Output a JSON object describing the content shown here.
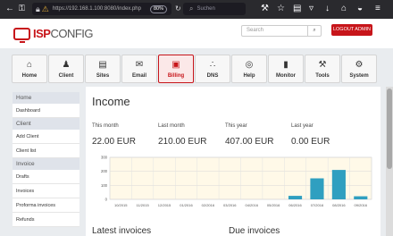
{
  "browser": {
    "url": "https://192.168.1.100:8080/index.php",
    "zoom": "80%",
    "search_placeholder": "Suchen"
  },
  "header": {
    "logo_isp": "ISP",
    "logo_config": "CONFIG",
    "search_placeholder": "Search",
    "logout_label": "LOGOUT ADMIN"
  },
  "modules": [
    {
      "label": "Home",
      "icon": "home-icon"
    },
    {
      "label": "Client",
      "icon": "users-icon"
    },
    {
      "label": "Sites",
      "icon": "sites-icon"
    },
    {
      "label": "Email",
      "icon": "email-icon"
    },
    {
      "label": "Billing",
      "icon": "billing-icon",
      "active": true
    },
    {
      "label": "DNS",
      "icon": "dns-icon"
    },
    {
      "label": "Help",
      "icon": "help-icon"
    },
    {
      "label": "Monitor",
      "icon": "monitor-icon"
    },
    {
      "label": "Tools",
      "icon": "tools-icon"
    },
    {
      "label": "System",
      "icon": "gear-icon"
    }
  ],
  "sidebar": {
    "home_head": "Home",
    "dashboard": "Dashboard",
    "client_head": "Client",
    "add_client": "Add Client",
    "client_list": "Client list",
    "invoice_head": "Invoice",
    "drafts": "Drafts",
    "invoices": "Invoices",
    "proforma": "Proforma invoices",
    "refunds": "Refunds"
  },
  "main": {
    "title": "Income",
    "stats": {
      "this_month_label": "This month",
      "this_month_value": "22.00 EUR",
      "last_month_label": "Last month",
      "last_month_value": "210.00 EUR",
      "this_year_label": "This year",
      "this_year_value": "407.00 EUR",
      "last_year_label": "Last year",
      "last_year_value": "0.00 EUR"
    },
    "latest_invoices": "Latest invoices",
    "due_invoices": "Due invoices"
  },
  "chart_data": {
    "type": "bar",
    "categories": [
      "10/2015",
      "11/2015",
      "12/2015",
      "01/2016",
      "02/2016",
      "03/2016",
      "04/2016",
      "05/2016",
      "06/2016",
      "07/2016",
      "08/2016",
      "09/2016"
    ],
    "values": [
      0,
      0,
      0,
      0,
      0,
      0,
      0,
      0,
      25,
      150,
      210,
      22
    ],
    "ylim": [
      0,
      300
    ],
    "yticks": [
      "0",
      "100",
      "200",
      "300"
    ],
    "bar_color": "#2f9fc0",
    "grid": true
  }
}
